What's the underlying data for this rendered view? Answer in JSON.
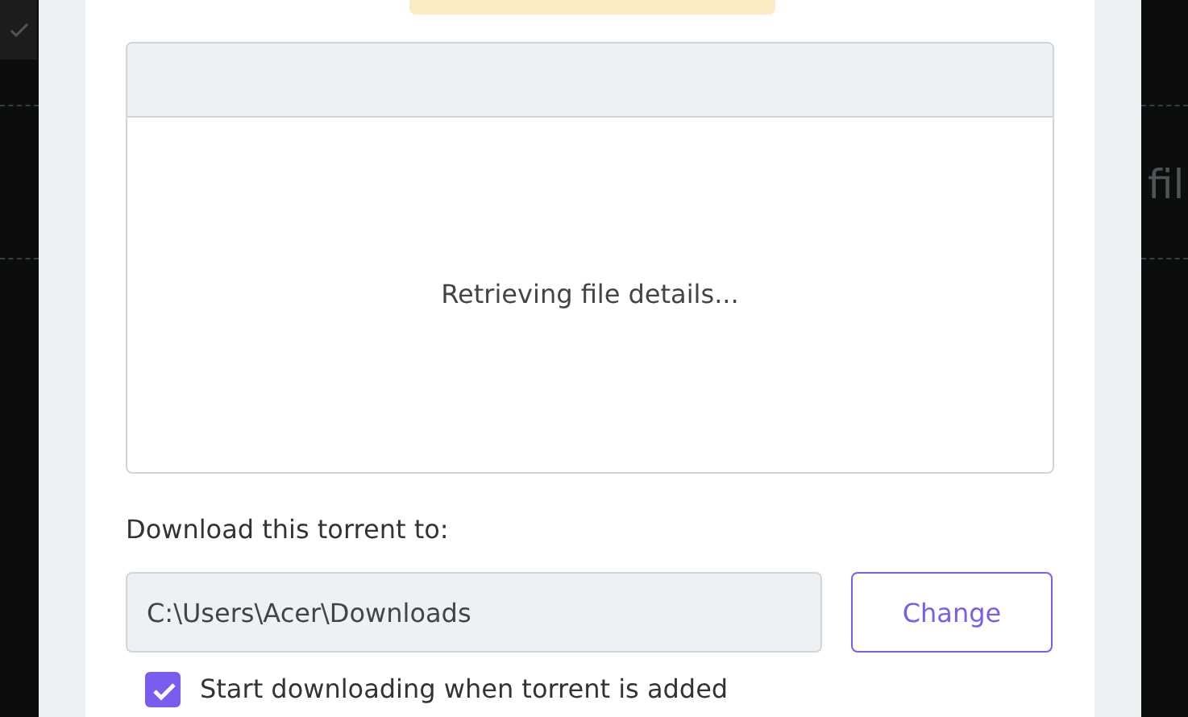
{
  "background": {
    "text": "fil"
  },
  "files_panel": {
    "status": "Retrieving file details..."
  },
  "destination": {
    "label": "Download this torrent to:",
    "path": "C:\\Users\\Acer\\Downloads",
    "button": "Change"
  },
  "start_option": {
    "label": "Start downloading when torrent is added",
    "checked": true
  }
}
